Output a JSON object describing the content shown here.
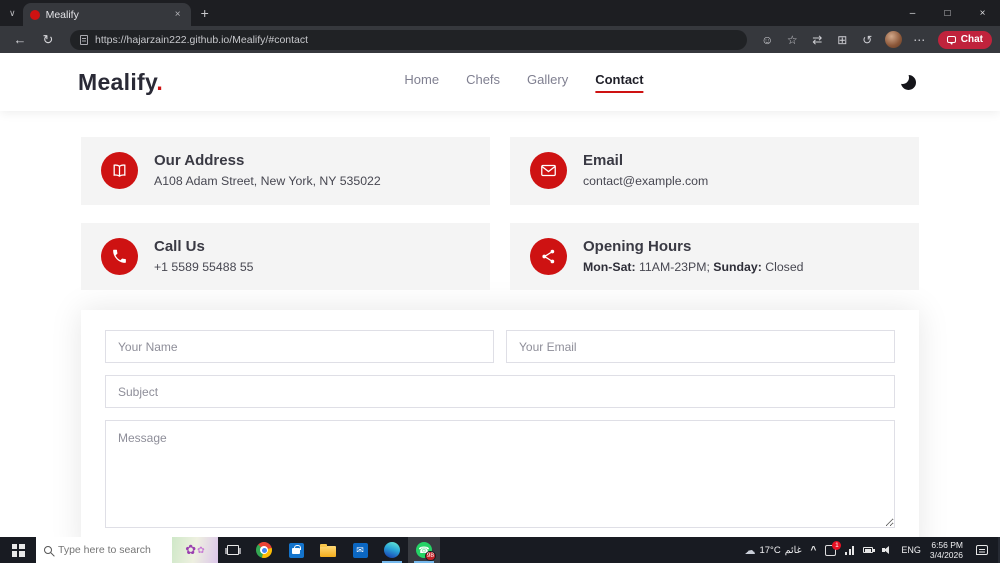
{
  "browser": {
    "tab_title": "Mealify",
    "url": "https://hajarzain222.github.io/Mealify/#contact",
    "chat_label": "Chat"
  },
  "icons": {
    "tab_chevron": "∨",
    "close": "×",
    "new_tab": "+",
    "minimize": "–",
    "maximize": "□",
    "back": "←",
    "refresh": "↻",
    "smiley": "☺",
    "star": "☆",
    "split": "⇄",
    "collections": "⊞",
    "history": "↺",
    "more": "⋯",
    "tray_chevron": "^",
    "cloud": "☁",
    "envelope": "✉",
    "phone": "☎",
    "flower": "✿"
  },
  "site": {
    "logo_text": "Mealify",
    "logo_dot": ".",
    "nav": [
      {
        "label": "Home"
      },
      {
        "label": "Chefs"
      },
      {
        "label": "Gallery"
      },
      {
        "label": "Contact"
      }
    ],
    "cards": [
      {
        "title": "Our Address",
        "text": "A108 Adam Street, New York, NY 535022"
      },
      {
        "title": "Email",
        "text": "contact@example.com"
      },
      {
        "title": "Call Us",
        "text": "+1 5589 55488 55"
      },
      {
        "title": "Opening Hours",
        "bold1": "Mon-Sat:",
        "text1": " 11AM-23PM; ",
        "bold2": "Sunday:",
        "text2": " Closed"
      }
    ],
    "form": {
      "name_placeholder": "Your Name",
      "email_placeholder": "Your Email",
      "subject_placeholder": "Subject",
      "message_placeholder": "Message"
    },
    "accent_color": "#ce1212"
  },
  "taskbar": {
    "search_placeholder": "Type here to search",
    "whatsapp_badge": "98",
    "tray_badge": "1",
    "weather_temp": "17°C",
    "weather_text": "غائم",
    "language": "ENG",
    "time": "6:56 PM",
    "date": "3/4/2026"
  }
}
